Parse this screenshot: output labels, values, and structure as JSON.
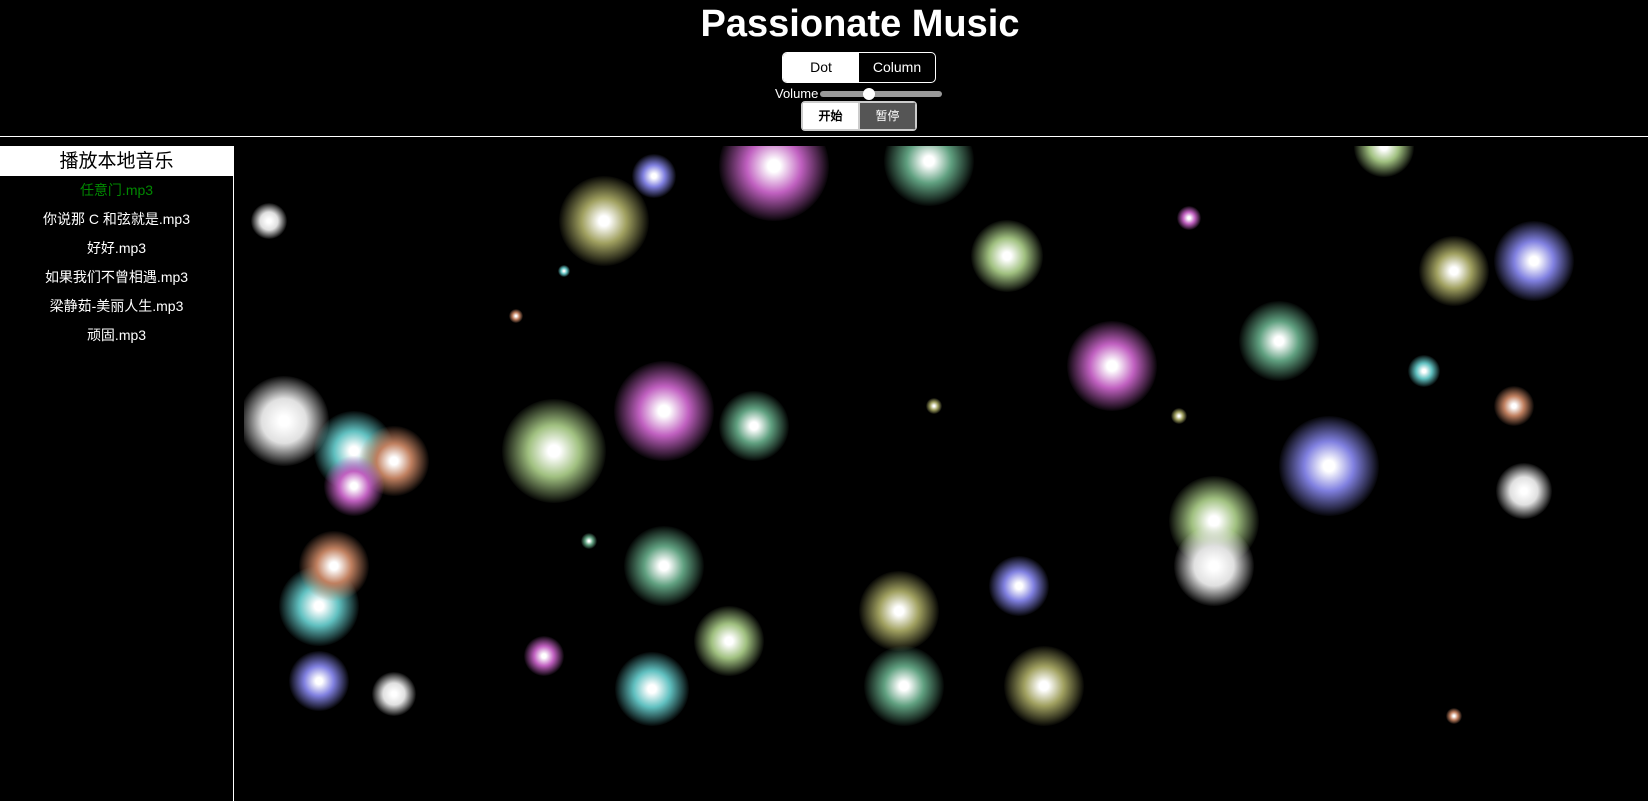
{
  "header": {
    "title": "Passionate Music"
  },
  "mode_toggle": {
    "options": [
      "Dot",
      "Column"
    ],
    "selected": "Dot"
  },
  "volume": {
    "label": "Volume",
    "value": 0.4
  },
  "controls": {
    "start_label": "开始",
    "pause_label": "暂停"
  },
  "sidebar": {
    "title": "播放本地音乐",
    "active_index": 0,
    "items": [
      {
        "label": "任意门.mp3"
      },
      {
        "label": "你说那 C 和弦就是.mp3"
      },
      {
        "label": "好好.mp3"
      },
      {
        "label": "如果我们不曾相遇.mp3"
      },
      {
        "label": "梁静茹-美丽人生.mp3"
      },
      {
        "label": "顽固.mp3"
      }
    ]
  },
  "visualizer": {
    "mode": "Dot",
    "colors": [
      "#c060c0",
      "#60a080",
      "#a0a060",
      "#8080e0",
      "#e0e0e0",
      "#60c0c0",
      "#c08060",
      "#a0c080"
    ]
  }
}
